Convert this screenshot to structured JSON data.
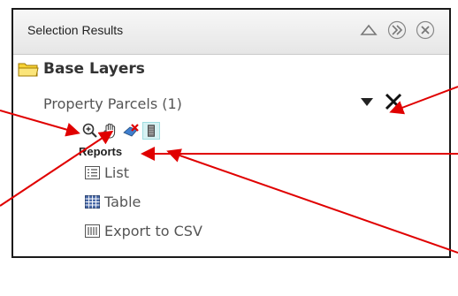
{
  "panel": {
    "title": "Selection Results",
    "header_icons": [
      "collapse-up-icon",
      "double-chevron-right-icon",
      "close-circle-icon"
    ]
  },
  "tree": {
    "group_label": "Base Layers",
    "layer_label": "Property Parcels (1)",
    "layer_controls": [
      "dropdown-arrow-icon",
      "remove-x-icon"
    ],
    "tools": [
      "zoom-to-icon",
      "pan-hand-icon",
      "clear-selection-icon",
      "highlight-icon"
    ]
  },
  "reports": {
    "label": "Reports",
    "items": [
      {
        "label": "List",
        "icon": "list-icon"
      },
      {
        "label": "Table",
        "icon": "table-icon"
      },
      {
        "label": "Export to CSV",
        "icon": "export-csv-icon"
      }
    ]
  },
  "colors": {
    "annotation_arrow": "#e00000",
    "folder": "#f2c200",
    "highlight_tool": "#d6f1f2"
  }
}
